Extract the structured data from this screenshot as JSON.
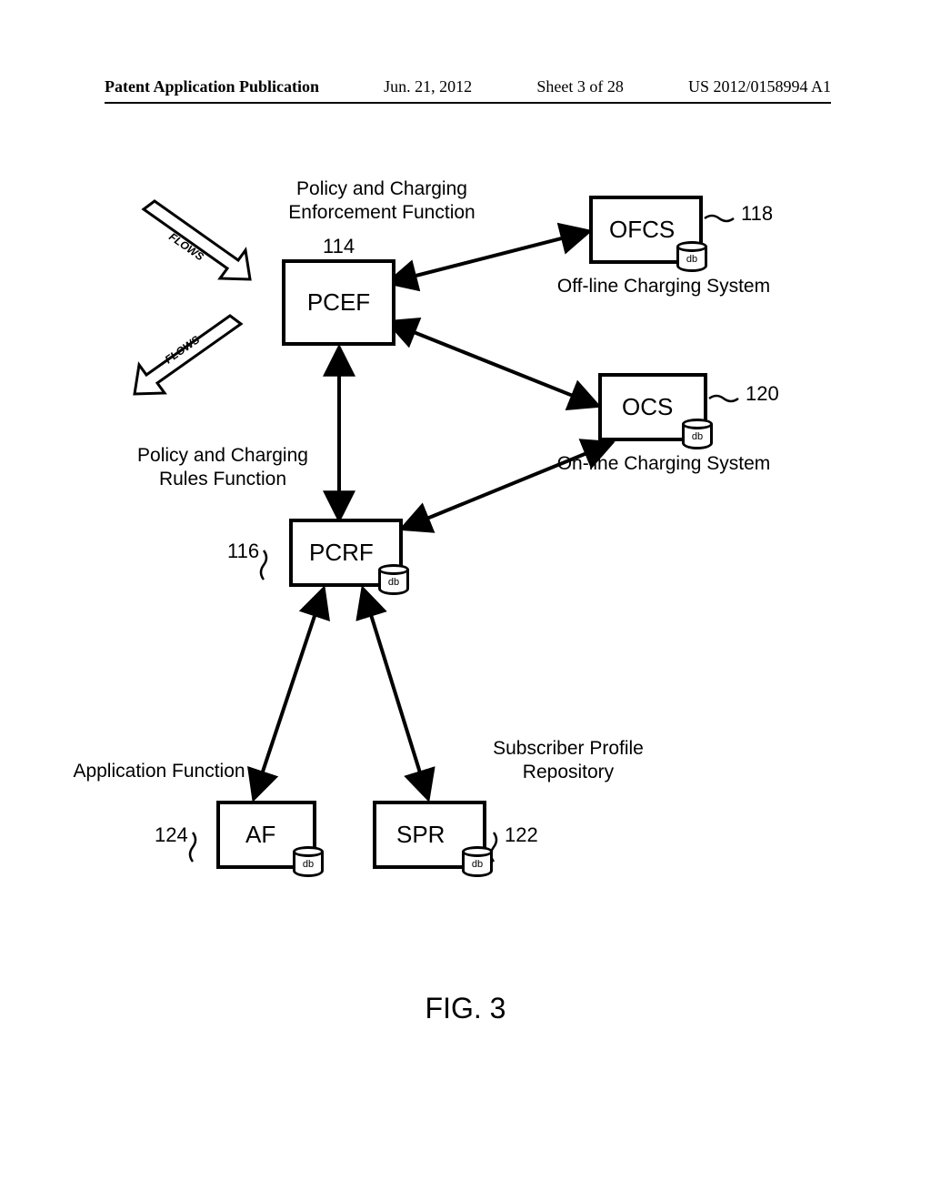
{
  "header": {
    "pub_type": "Patent Application Publication",
    "date": "Jun. 21, 2012",
    "sheet": "Sheet 3 of 28",
    "pub_number": "US 2012/0158994 A1"
  },
  "labels": {
    "pcef_title": "Policy and Charging\nEnforcement Function",
    "pcrf_title": "Policy and Charging\nRules Function",
    "ofcs_title": "Off-line Charging System",
    "ocs_title": "On-line Charging System",
    "af_title": "Application Function",
    "spr_title": "Subscriber Profile\nRepository"
  },
  "nodes": {
    "pcef": {
      "text": "PCEF",
      "ref": "114"
    },
    "pcrf": {
      "text": "PCRF",
      "ref": "116"
    },
    "ofcs": {
      "text": "OFCS",
      "ref": "118"
    },
    "ocs": {
      "text": "OCS",
      "ref": "120"
    },
    "spr": {
      "text": "SPR",
      "ref": "122"
    },
    "af": {
      "text": "AF",
      "ref": "124"
    }
  },
  "db_label": "db",
  "flows_label": "FLOWS",
  "figure": "FIG. 3"
}
